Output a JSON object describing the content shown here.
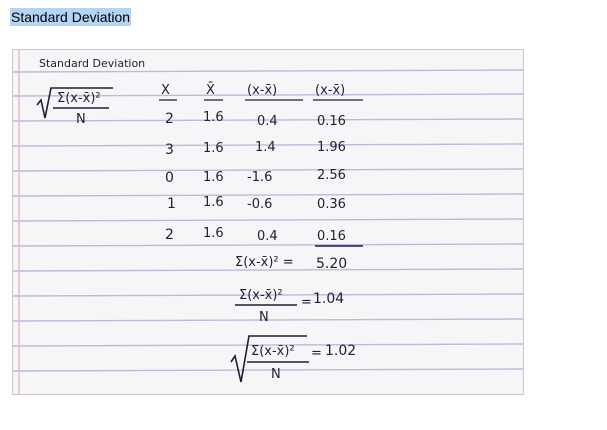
{
  "page": {
    "title": "Standard Deviation"
  },
  "photo": {
    "formula_label": "Standard Deviation",
    "formula_numerator": "Σ(x-x̄)²",
    "formula_denominator": "N",
    "headers": [
      "X",
      "X̄",
      "(x-x̄)",
      "(x-x̄)"
    ],
    "rows": [
      [
        "2",
        "1.6",
        "0.4",
        "0.16"
      ],
      [
        "3",
        "1.6",
        "1.4",
        "1.96"
      ],
      [
        "0",
        "1.6",
        "-1.6",
        "2.56"
      ],
      [
        "1",
        "1.6",
        "-0.6",
        "0.36"
      ],
      [
        "2",
        "1.6",
        "0.4",
        "0.16"
      ]
    ],
    "sum_label": "Σ(x-x̄)² =",
    "sum_value": "5.20",
    "variance_numerator": "Σ(x-x̄)²",
    "variance_denominator": "N",
    "variance_value": "1.04",
    "sd_numerator": "Σ(x-x̄)²",
    "sd_denominator": "N",
    "sd_value": "1.02",
    "ink_color": "#1f1e35",
    "paper_color": "#f7f5f8",
    "rule_color": "#b9bcdb",
    "margin_color": "#e3b9c8"
  }
}
